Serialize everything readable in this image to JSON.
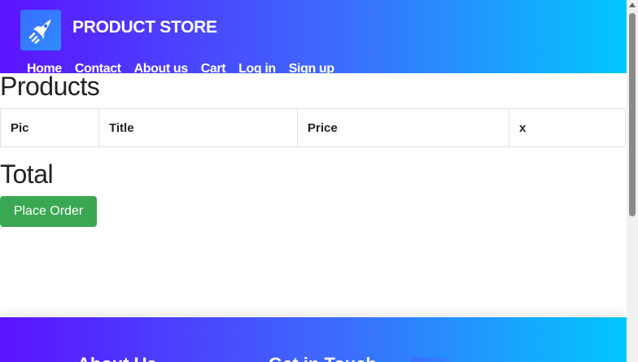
{
  "header": {
    "brand": "PRODUCT STORE",
    "logo_icon": "rocket-icon",
    "nav": [
      "Home",
      "Contact",
      "About us",
      "Cart",
      "Log in",
      "Sign up"
    ],
    "gradient_colors": [
      "#5b13ff",
      "#00c8ff"
    ]
  },
  "main": {
    "products_heading": "Products",
    "table_headers": [
      "Pic",
      "Title",
      "Price",
      "x"
    ],
    "total_heading": "Total",
    "place_order_label": "Place Order",
    "place_order_color": "#3aa853"
  },
  "footer": {
    "col1_title": "About Us",
    "col2_title": "Get in Touch"
  }
}
